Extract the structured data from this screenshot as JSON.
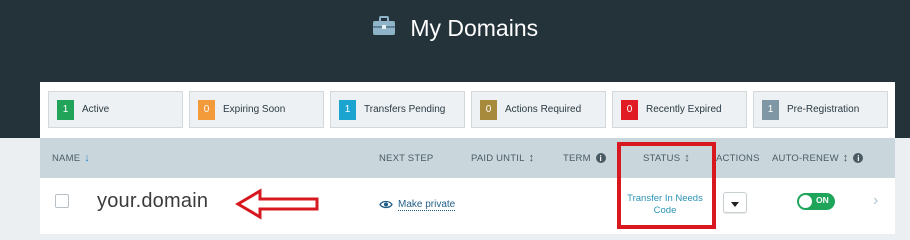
{
  "header": {
    "title": "My Domains",
    "icon": "briefcase-icon"
  },
  "filters": [
    {
      "count": "1",
      "label": "Active",
      "color": "#22a35a"
    },
    {
      "count": "0",
      "label": "Expiring Soon",
      "color": "#f39a3a"
    },
    {
      "count": "1",
      "label": "Transfers Pending",
      "color": "#1ba4cf"
    },
    {
      "count": "0",
      "label": "Actions Required",
      "color": "#a88a3c"
    },
    {
      "count": "0",
      "label": "Recently Expired",
      "color": "#e01b23"
    },
    {
      "count": "1",
      "label": "Pre-Registration",
      "color": "#7f97a4"
    }
  ],
  "table": {
    "columns": {
      "name": "NAME",
      "next_step": "NEXT STEP",
      "paid_until": "PAID UNTIL",
      "term": "TERM",
      "status": "STATUS",
      "actions": "ACTIONS",
      "auto_renew": "AUTO-RENEW"
    },
    "rows": [
      {
        "domain": "your.domain",
        "next_step": "Make private",
        "status": "Transfer In Needs Code",
        "auto_renew": "ON"
      }
    ]
  },
  "colors": {
    "header_bg": "#24323a",
    "table_header_bg": "#c9d7dd",
    "highlight": "#d7191f",
    "toggle_on": "#1fa55a",
    "link": "#1f5e88"
  }
}
